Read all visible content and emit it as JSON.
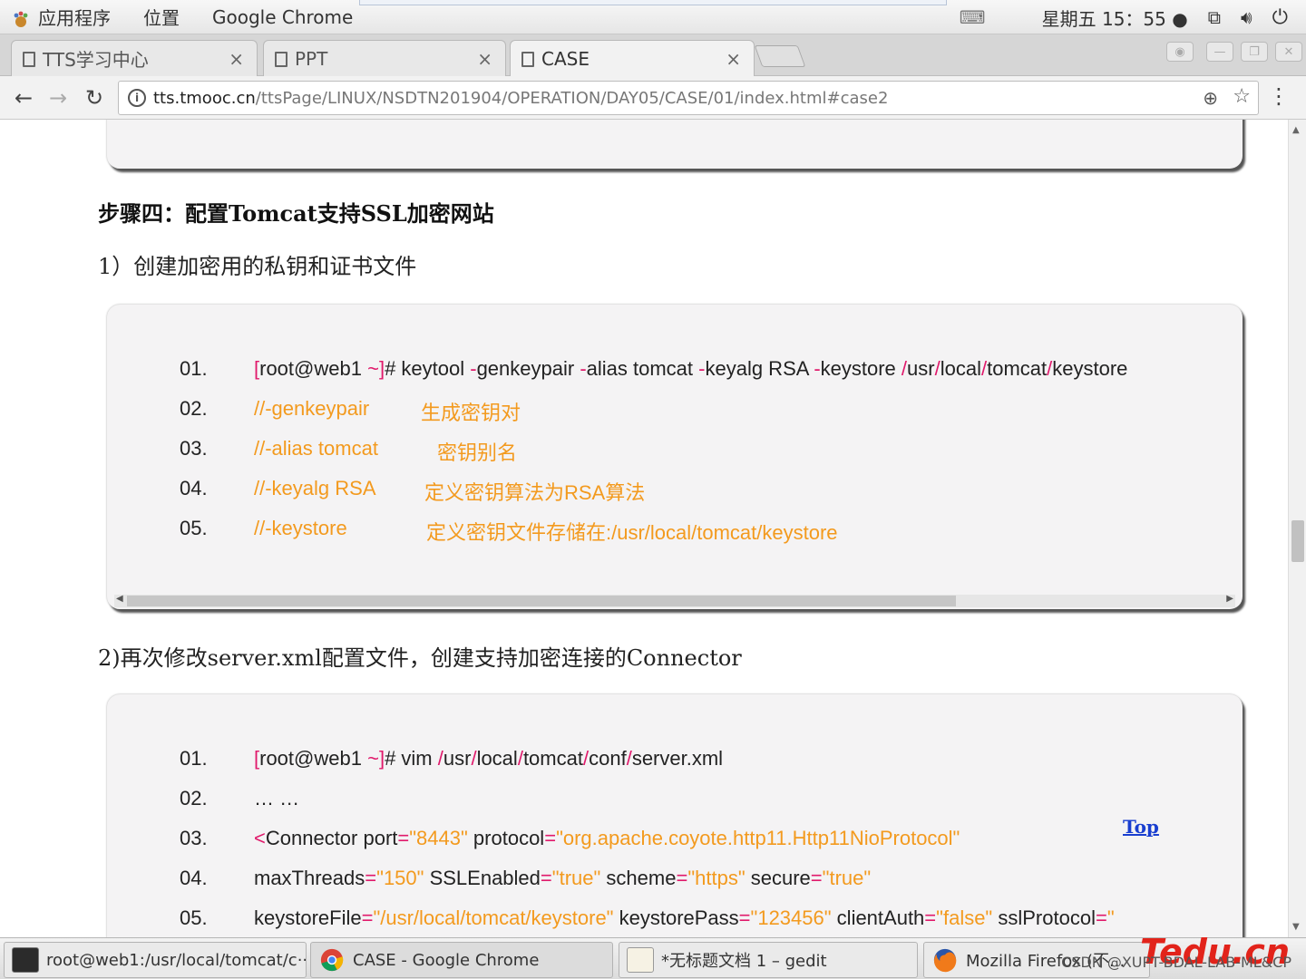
{
  "panel": {
    "menu": [
      "应用程序",
      "位置",
      "Google Chrome"
    ],
    "clock": "星期五 15：55 ●"
  },
  "tabs": [
    {
      "title": "TTS学习中心",
      "close": "×"
    },
    {
      "title": "PPT",
      "close": "×"
    },
    {
      "title": "CASE",
      "close": "×"
    }
  ],
  "toolbar": {
    "url_host": "tts.tmooc.cn",
    "url_path": "/ttsPage/LINUX/NSDTN201904/OPERATION/DAY05/CASE/01/index.html#case2"
  },
  "content": {
    "step_title": "步骤四：配置Tomcat支持SSL加密网站",
    "sub1": "1）创建加密用的私钥和证书文件",
    "sub2": "2)再次修改server.xml配置文件，创建支持加密连接的Connector",
    "top_link": "Top",
    "block1": {
      "nums": [
        "01.",
        "02.",
        "03.",
        "04.",
        "05."
      ],
      "line1": {
        "prompt_open": "[",
        "prompt_host": "root@web1",
        "prompt_tilde": " ~",
        "prompt_close": "]",
        "hash": "# keytool ",
        "d1": "-",
        "genkeypair": "genkeypair ",
        "d2": "-",
        "alias": "alias tomcat ",
        "d3": "-",
        "keyalg": "keyalg RSA ",
        "d4": "-",
        "keystore": "keystore ",
        "s1": "/",
        "usr": "usr",
        "s2": "/",
        "local": "local",
        "s3": "/",
        "tomcat": "tomcat",
        "s4": "/",
        "ks": "keystore"
      },
      "comments": [
        {
          "key": "//-genkeypair",
          "desc": "生成密钥对"
        },
        {
          "key": "//-alias tomcat",
          "desc": "密钥别名"
        },
        {
          "key": "//-keyalg RSA",
          "desc": "定义密钥算法为RSA算法"
        },
        {
          "key": "//-keystore",
          "desc": "定义密钥文件存储在:/usr/local/tomcat/keystore"
        }
      ]
    },
    "block2": {
      "nums": [
        "01.",
        "02.",
        "03.",
        "04.",
        "05."
      ],
      "line1": {
        "prompt_open": "[",
        "prompt_host": "root@web1",
        "prompt_tilde": " ~",
        "prompt_close": "]",
        "cmd": "# vim ",
        "s1": "/",
        "usr": "usr",
        "s2": "/",
        "local": "local",
        "s3": "/",
        "tomcat": "tomcat",
        "s4": "/",
        "conf": "conf",
        "s5": "/",
        "file": "server.xml"
      },
      "line2": "… …",
      "line3": {
        "lt": "<",
        "tag": "Connector port",
        "eq1": "=",
        "v1": "\"8443\"",
        "a2": " protocol",
        "eq2": "=",
        "v2": "\"org.apache.coyote.http11.Http11NioProtocol\""
      },
      "line4": {
        "a1": "maxThreads",
        "eq1": "=",
        "v1": "\"150\"",
        "a2": " SSLEnabled",
        "eq2": "=",
        "v2": "\"true\"",
        "a3": " scheme",
        "eq3": "=",
        "v3": "\"https\"",
        "a4": " secure",
        "eq4": "=",
        "v4": "\"true\""
      },
      "line5": {
        "a1": "keystoreFile",
        "eq1": "=",
        "v1": "\"/usr/local/tomcat/keystore\"",
        "a2": " keystorePass",
        "eq2": "=",
        "v2": "\"123456\"",
        "a3": " clientAuth",
        "eq3": "=",
        "v3": "\"false\"",
        "a4": " sslProtocol",
        "eq4": "=",
        "v4": "\""
      }
    }
  },
  "taskbar": [
    {
      "label": "root@web1:/usr/local/tomcat/c···",
      "icon": "terminal-icon"
    },
    {
      "label": "CASE - Google Chrome",
      "icon": "chrome-icon"
    },
    {
      "label": "*无标题文档 1 – gedit",
      "icon": "gedit-icon"
    },
    {
      "label": "Mozilla Firefox (不...",
      "icon": "firefox-icon"
    }
  ],
  "watermark": "CSDN @XUPT-BDAL-LAB-ML&CP",
  "logo": "Tedu.cn",
  "colors": {
    "prompt": "#e0196b",
    "comment": "#f39a1e",
    "link": "#1a3fd0"
  }
}
